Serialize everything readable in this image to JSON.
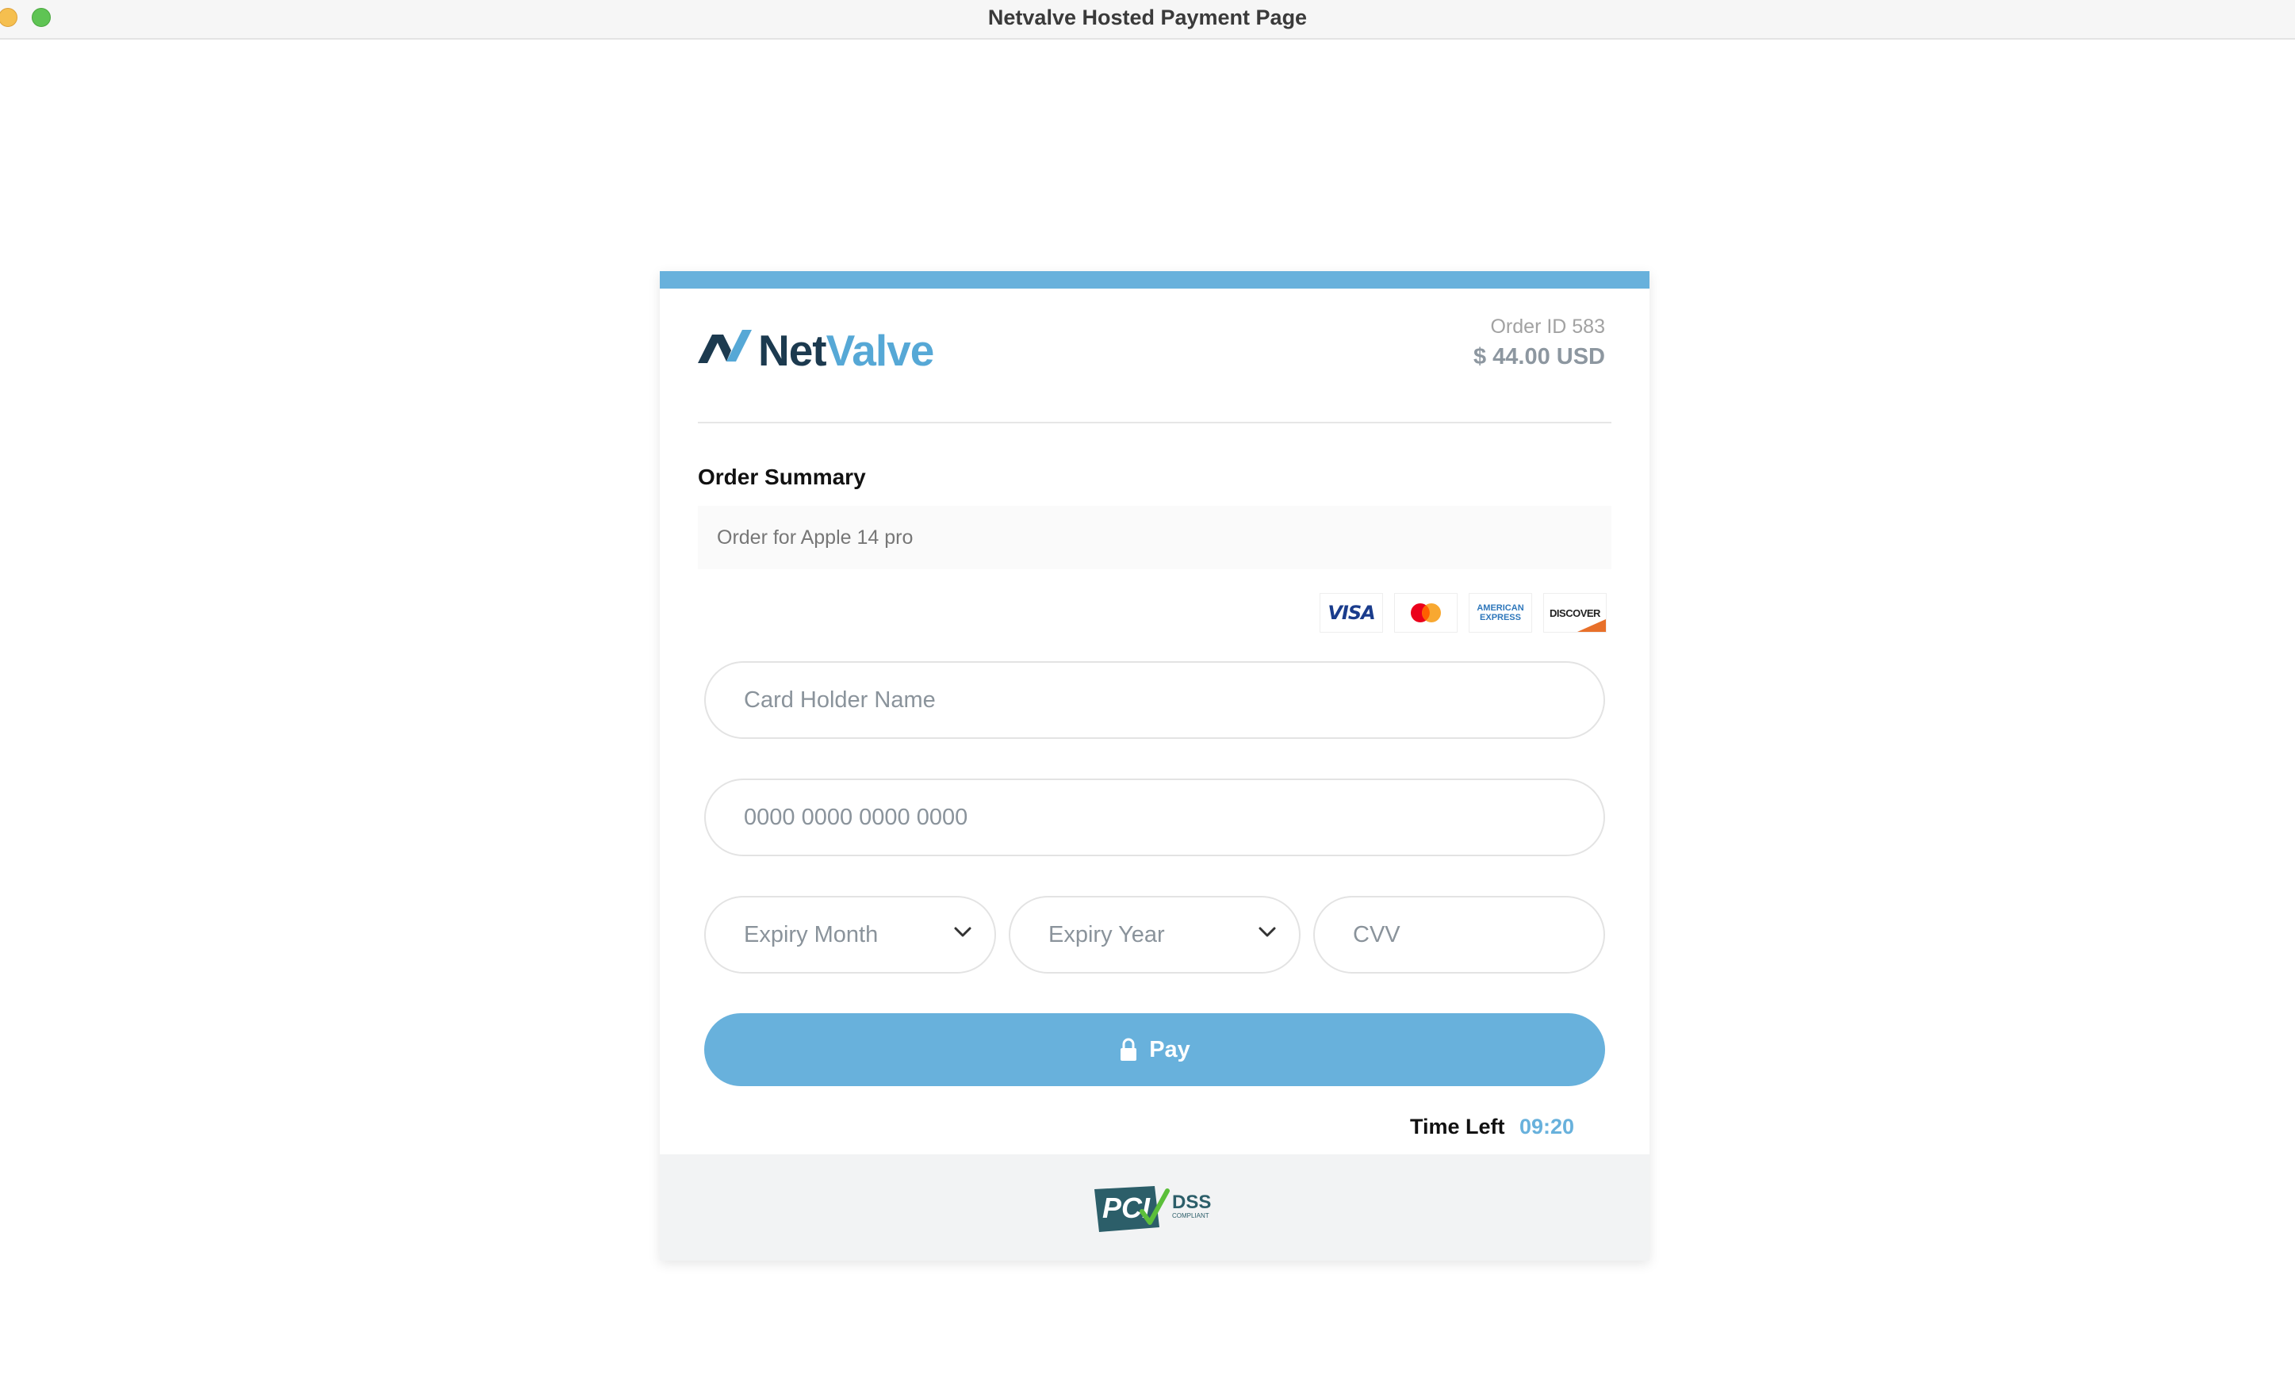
{
  "window": {
    "title": "Netvalve Hosted Payment Page"
  },
  "brand": {
    "name_part1": "Net",
    "name_part2": "Valve"
  },
  "order": {
    "id_label": "Order ID 583",
    "amount": "$ 44.00 USD"
  },
  "summary": {
    "heading": "Order Summary",
    "description": "Order for Apple 14 pro"
  },
  "card_brands": {
    "visa": "VISA",
    "amex_line1": "AMERICAN",
    "amex_line2": "EXPRESS",
    "discover": "DISCOVER"
  },
  "form": {
    "card_holder_placeholder": "Card Holder Name",
    "card_number_placeholder": "0000 0000 0000 0000",
    "expiry_month_label": "Expiry Month",
    "expiry_year_label": "Expiry Year",
    "cvv_placeholder": "CVV"
  },
  "pay_button": {
    "label": "Pay"
  },
  "timer": {
    "label": "Time Left",
    "value": "09:20"
  },
  "footer": {
    "pci_text": "PCI",
    "dss_text": "DSS",
    "compliant_text": "COMPLIANT"
  },
  "colors": {
    "accent": "#68b1dc",
    "brand_dark": "#1c3a4f",
    "brand_light": "#56a8d6"
  },
  "icons": {
    "lock": "lock-icon",
    "chevron": "chevron-down-icon",
    "mastercard": "mastercard-logo"
  }
}
